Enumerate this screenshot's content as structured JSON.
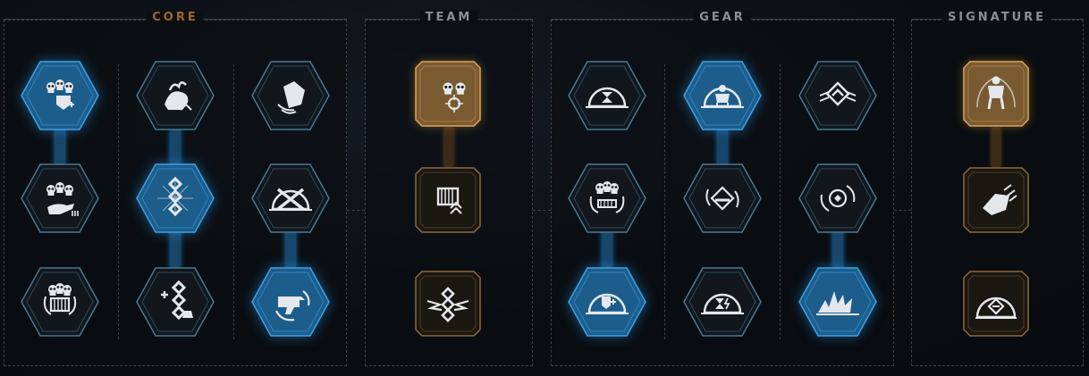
{
  "panels": {
    "core": {
      "title": "CORE"
    },
    "team": {
      "title": "TEAM"
    },
    "gear": {
      "title": "GEAR"
    },
    "signature": {
      "title": "SIGNATURE"
    }
  },
  "colors": {
    "active_blue": "#1d5d8c",
    "active_gold": "#7a5a30",
    "inactive": "#12171d",
    "core_title": "#a0672a",
    "section_title": "#8a9098"
  },
  "core_perks": [
    {
      "icon": "squad-skulls-shield-icon",
      "active": true
    },
    {
      "icon": "flaming-fist-icon",
      "active": false
    },
    {
      "icon": "hand-aura-icon",
      "active": false
    },
    {
      "icon": "squad-skulls-hand-icon",
      "active": false
    },
    {
      "icon": "chain-link-burst-icon",
      "active": true
    },
    {
      "icon": "crossed-bolters-dome-icon",
      "active": false
    },
    {
      "icon": "skulls-crate-arrows-icon",
      "active": false
    },
    {
      "icon": "chain-plus-weight-icon",
      "active": false
    },
    {
      "icon": "bolter-cycle-icon",
      "active": true
    }
  ],
  "team_perks": [
    {
      "icon": "skull-target-icon",
      "active": true
    },
    {
      "icon": "ammo-crate-icon",
      "active": false
    },
    {
      "icon": "winged-chain-icon",
      "active": false
    }
  ],
  "gear_perks": [
    {
      "icon": "hourglass-dome-icon",
      "active": false
    },
    {
      "icon": "marine-dome-icon",
      "active": true
    },
    {
      "icon": "winged-diamond-icon",
      "active": false
    },
    {
      "icon": "squad-ammo-cycle-icon",
      "active": false
    },
    {
      "icon": "shield-diamond-cycle-icon",
      "active": false
    },
    {
      "icon": "reticle-cycle-icon",
      "active": false
    },
    {
      "icon": "plus-dome-icon",
      "active": true
    },
    {
      "icon": "hourglass-bolt-dome-icon",
      "active": false
    },
    {
      "icon": "impact-burst-icon",
      "active": true
    }
  ],
  "signature_perks": [
    {
      "icon": "marine-aura-icon",
      "active": true
    },
    {
      "icon": "energy-fist-icon",
      "active": false
    },
    {
      "icon": "diamond-dome-icon",
      "active": false
    }
  ]
}
